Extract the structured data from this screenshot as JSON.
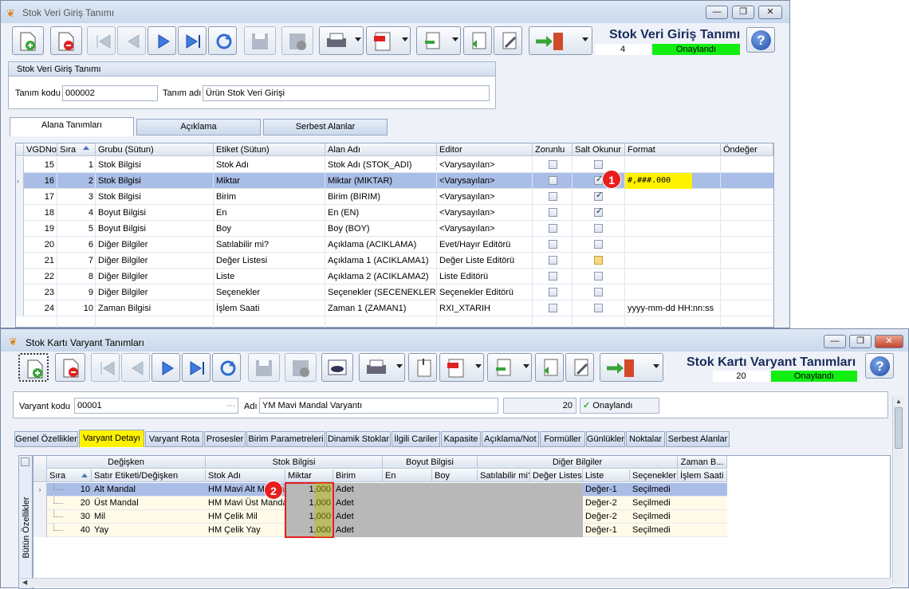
{
  "win1": {
    "title": "Stok Veri Giriş Tanımı",
    "heading": "Stok Veri Giriş Tanımı",
    "record_no": "4",
    "status": "Onaylandı",
    "form": {
      "group_title": "Stok Veri Giriş Tanımı",
      "code_label": "Tanım kodu",
      "code_value": "000002",
      "name_label": "Tanım adı",
      "name_value": "Ürün Stok Veri Girişi"
    },
    "tabs": [
      "Alana Tanımları",
      "Açıklama",
      "Serbest Alanlar"
    ],
    "columns": [
      "VGDNo",
      "Sıra",
      "Grubu (Sütun)",
      "Etiket (Sütun)",
      "Alan Adı",
      "Editor",
      "Zorunlu",
      "Salt Okunur",
      "Format",
      "Öndeğer"
    ],
    "rows": [
      {
        "vgd": "15",
        "sira": "1",
        "grubu": "Stok Bilgisi",
        "etiket": "Stok Adı",
        "alan": "Stok Adı (STOK_ADI)",
        "editor": "<Varysayılan>",
        "format": ""
      },
      {
        "vgd": "16",
        "sira": "2",
        "grubu": "Stok Bilgisi",
        "etiket": "Miktar",
        "alan": "Miktar (MIKTAR)",
        "editor": "<Varysayılan>",
        "format": "#,###.000"
      },
      {
        "vgd": "17",
        "sira": "3",
        "grubu": "Stok Bilgisi",
        "etiket": "Birim",
        "alan": "Birim (BIRIM)",
        "editor": "<Varysayılan>",
        "format": ""
      },
      {
        "vgd": "18",
        "sira": "4",
        "grubu": "Boyut Bilgisi",
        "etiket": "En",
        "alan": "En (EN)",
        "editor": "<Varysayılan>",
        "format": ""
      },
      {
        "vgd": "19",
        "sira": "5",
        "grubu": "Boyut Bilgisi",
        "etiket": "Boy",
        "alan": "Boy (BOY)",
        "editor": "<Varysayılan>",
        "format": ""
      },
      {
        "vgd": "20",
        "sira": "6",
        "grubu": "Diğer Bilgiler",
        "etiket": "Satılabilir mi?",
        "alan": "Açıklama (ACIKLAMA)",
        "editor": "Evet/Hayır Editörü",
        "format": ""
      },
      {
        "vgd": "21",
        "sira": "7",
        "grubu": "Diğer Bilgiler",
        "etiket": "Değer Listesi",
        "alan": "Açıklama 1 (ACIKLAMA1)",
        "editor": "Değer Liste Editörü",
        "format": ""
      },
      {
        "vgd": "22",
        "sira": "8",
        "grubu": "Diğer Bilgiler",
        "etiket": "Liste",
        "alan": "Açıklama 2 (ACIKLAMA2)",
        "editor": "Liste Editörü",
        "format": ""
      },
      {
        "vgd": "23",
        "sira": "9",
        "grubu": "Diğer Bilgiler",
        "etiket": "Seçenekler",
        "alan": "Seçenekler (SECENEKLER)",
        "editor": "Seçenekler Editörü",
        "format": ""
      },
      {
        "vgd": "24",
        "sira": "10",
        "grubu": "Zaman Bilgisi",
        "etiket": "İşlem Saati",
        "alan": "Zaman 1 (ZAMAN1)",
        "editor": "RXI_XTARIH",
        "format": "yyyy-mm-dd HH:nn:ss"
      }
    ],
    "badge": "1"
  },
  "win2": {
    "title": "Stok Kartı Varyant Tanımları",
    "heading": "Stok Kartı Varyant Tanımları",
    "record_no": "20",
    "status": "Onaylandı",
    "form": {
      "code_label": "Varyant kodu",
      "code_value": "00001",
      "ellipsis": "···",
      "name_label": "Adı",
      "name_value": "YM Mavi Mandal Varyantı",
      "count": "20",
      "approved": "Onaylandı"
    },
    "tabs": [
      "Genel Özellikler",
      "Varyant Detayı",
      "Varyant Rota",
      "Prosesler",
      "Birim Parametreleri",
      "Dinamik Stoklar",
      "İlgili Cariler",
      "Kapasite",
      "Açıklama/Not",
      "Formüller",
      "Günlükler",
      "Noktalar",
      "Serbest Alanlar"
    ],
    "side_label": "Bütün Özellikler",
    "bands": [
      "Değişken",
      "Stok Bilgisi",
      "Boyut Bilgisi",
      "Diğer Bilgiler",
      "Zaman B..."
    ],
    "columns": [
      "Sıra",
      "Satır Etiketi/Değişken",
      "Stok Adı",
      "Miktar",
      "Birim",
      "En",
      "Boy",
      "Satılabilir mi?",
      "Değer Listesi",
      "Liste",
      "Seçenekler",
      "İşlem Saati"
    ],
    "rows": [
      {
        "sira": "10",
        "etiket": "Alt Mandal",
        "stok": "HM Mavi Alt Mandal",
        "miktar": "1,000",
        "birim": "Adet",
        "liste": "Değer-1",
        "secenek": "Seçilmedi"
      },
      {
        "sira": "20",
        "etiket": "Üst Mandal",
        "stok": "HM Mavi Üst Mandal",
        "miktar": "1,000",
        "birim": "Adet",
        "liste": "Değer-2",
        "secenek": "Seçilmedi"
      },
      {
        "sira": "30",
        "etiket": "Mil",
        "stok": "HM Çelik Mil",
        "miktar": "1,000",
        "birim": "Adet",
        "liste": "Değer-2",
        "secenek": "Seçilmedi"
      },
      {
        "sira": "40",
        "etiket": "Yay",
        "stok": "HM Çelik Yay",
        "miktar": "1,000",
        "birim": "Adet",
        "liste": "Değer-1",
        "secenek": "Seçilmedi"
      }
    ],
    "badge": "2"
  },
  "colors": {
    "accent": "#1b2c5a",
    "selected_row": "#a9bde6",
    "status_green": "#12ee12",
    "highlight_yellow": "#fff200",
    "badge_red": "#e81d1d"
  }
}
